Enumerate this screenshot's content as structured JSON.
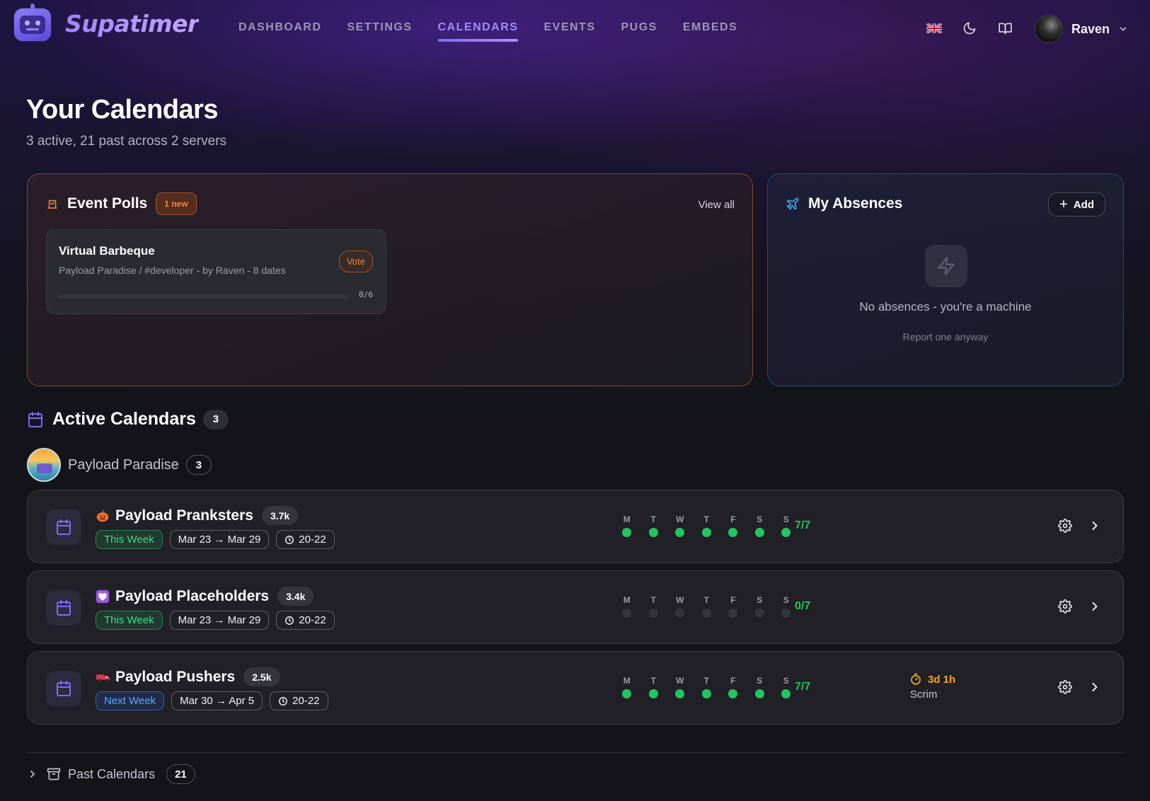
{
  "nav": {
    "brand": "Supatimer",
    "links": [
      "DASHBOARD",
      "SETTINGS",
      "CALENDARS",
      "EVENTS",
      "PUGS",
      "EMBEDS"
    ],
    "active": "CALENDARS",
    "icons": [
      "uk-flag-icon",
      "moon-icon",
      "book-icon"
    ],
    "user": "Raven"
  },
  "header": {
    "title": "Your Calendars",
    "subtitle": "3 active, 21 past across 2 servers"
  },
  "polls": {
    "title": "Event Polls",
    "badge": "1 new",
    "view_all": "View all",
    "item": {
      "name": "Virtual Barbeque",
      "meta": "Payload Paradise / #developer - by Raven - 8 dates",
      "vote": "Vote",
      "progress_text": "0/6",
      "progress_fraction": 0
    }
  },
  "absences": {
    "title": "My Absences",
    "add": "Add",
    "empty": "No absences - you're a machine",
    "report": "Report one anyway"
  },
  "active": {
    "title": "Active Calendars",
    "count": "3",
    "server": {
      "name": "Payload Paradise",
      "count": "3"
    },
    "calendars": [
      {
        "emoji": "pumpkin-icon",
        "name": "Payload Pranksters",
        "members": "3.7k",
        "week": "This Week",
        "week_color": "green",
        "range": "Mar 23 → Mar 29",
        "time": "20-22",
        "days": [
          "M",
          "T",
          "W",
          "T",
          "F",
          "S",
          "S"
        ],
        "filled": [
          true,
          true,
          true,
          true,
          true,
          true,
          true
        ],
        "ratio": "7/7",
        "timer": null
      },
      {
        "emoji": "heart-icon",
        "name": "Payload Placeholders",
        "members": "3.4k",
        "week": "This Week",
        "week_color": "green",
        "range": "Mar 23 → Mar 29",
        "time": "20-22",
        "days": [
          "M",
          "T",
          "W",
          "T",
          "F",
          "S",
          "S"
        ],
        "filled": [
          false,
          false,
          false,
          false,
          false,
          false,
          false
        ],
        "ratio": "0/7",
        "timer": null
      },
      {
        "emoji": "truck-icon",
        "name": "Payload Pushers",
        "members": "2.5k",
        "week": "Next Week",
        "week_color": "blue",
        "range": "Mar 30 → Apr 5",
        "time": "20-22",
        "days": [
          "M",
          "T",
          "W",
          "T",
          "F",
          "S",
          "S"
        ],
        "filled": [
          true,
          true,
          true,
          true,
          true,
          true,
          true
        ],
        "ratio": "7/7",
        "timer": {
          "value": "3d 1h",
          "label": "Scrim"
        }
      }
    ]
  },
  "past": {
    "title": "Past Calendars",
    "count": "21"
  },
  "colors": {
    "accent": "#9f8cff",
    "green": "#22c55e",
    "orange": "#ef8a3c",
    "amber": "#f5a524",
    "blue": "#5aa7ff"
  }
}
